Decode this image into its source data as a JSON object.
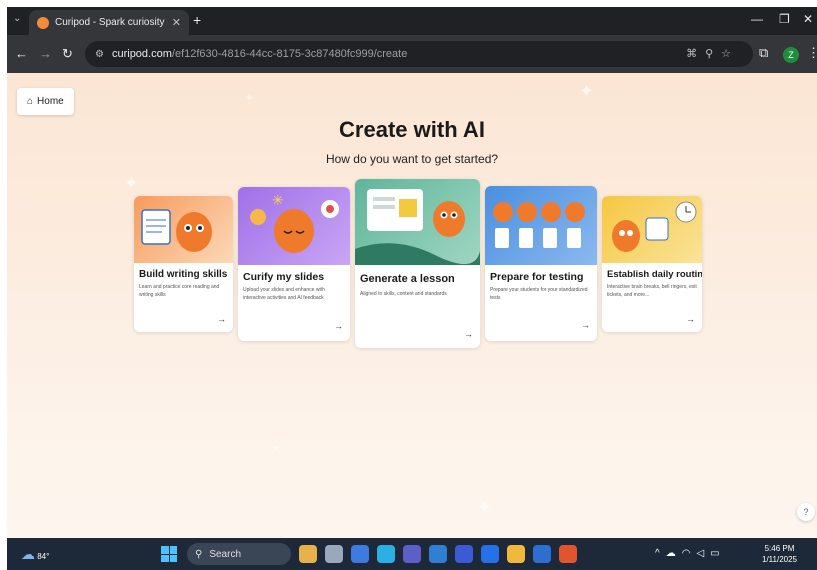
{
  "browser": {
    "tab_title": "Curipod - Spark curiosity with s",
    "url_host": "curipod.com",
    "url_path": "/ef12f630-4816-44cc-8175-3c87480fc999/create",
    "profile_initial": "Z"
  },
  "page": {
    "home_label": "Home",
    "title": "Create with AI",
    "subtitle": "How do you want to get started?",
    "cards": [
      {
        "title": "Build writing skills",
        "description": "Learn and practice core reading and writing skills",
        "arrow": "→",
        "colors": [
          "#f79b5c",
          "#fbd9b8"
        ]
      },
      {
        "title": "Curify my slides",
        "description": "Upload your slides and enhance with interactive activities and AI feedback",
        "arrow": "→",
        "colors": [
          "#a070e8",
          "#c9a6f5"
        ]
      },
      {
        "title": "Generate a lesson",
        "description": "Aligned to skills, content and standards",
        "arrow": "→",
        "colors": [
          "#5fb59a",
          "#9fd6c2"
        ]
      },
      {
        "title": "Prepare for testing",
        "description": "Prepare your students for your standardized tests",
        "arrow": "→",
        "colors": [
          "#4a8fe0",
          "#8bb9ef"
        ]
      },
      {
        "title": "Establish daily routines",
        "description": "Interactive brain breaks, bell ringers, exit tickets, and more...",
        "arrow": "→",
        "colors": [
          "#f5c842",
          "#fae39a"
        ]
      }
    ],
    "help_label": "?"
  },
  "taskbar": {
    "weather": "84°",
    "search_label": "Search",
    "time": "5:46 PM",
    "date": "1/11/2025",
    "app_colors": [
      "#e8b24a",
      "#9aa8bd",
      "#3d7be0",
      "#2bb0e6",
      "#5b5fc7",
      "#2f80d1",
      "#3c5ad4",
      "#2572e8",
      "#f0b93a",
      "#2c6fd1",
      "#e0542e"
    ]
  }
}
